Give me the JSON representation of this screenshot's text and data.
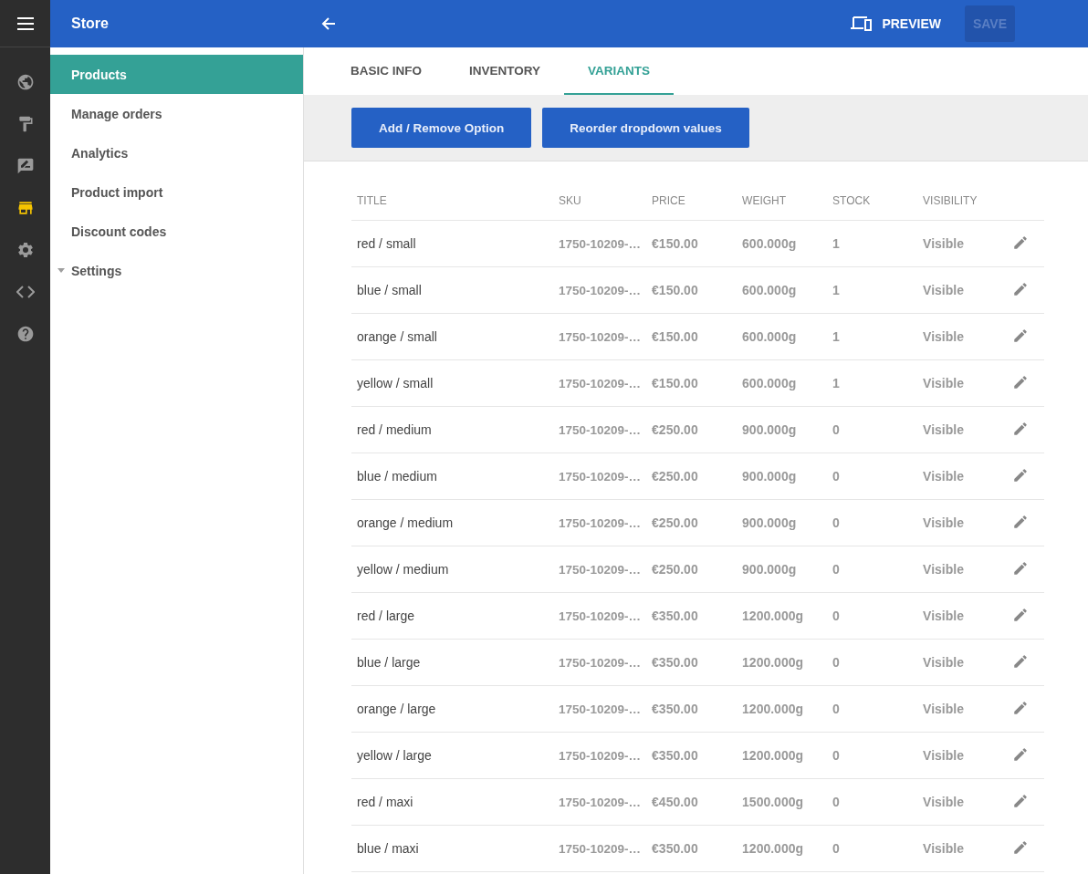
{
  "rail": [
    {
      "kind": "menu",
      "selected": false
    },
    {
      "kind": "globe",
      "selected": false
    },
    {
      "kind": "roller",
      "selected": false
    },
    {
      "kind": "feedback",
      "selected": false
    },
    {
      "kind": "store",
      "selected": true
    },
    {
      "kind": "gear",
      "selected": false
    },
    {
      "kind": "code",
      "selected": false
    },
    {
      "kind": "help",
      "selected": false
    }
  ],
  "sidebar": {
    "title": "Store",
    "items": [
      {
        "label": "Products",
        "selected": true,
        "kind": "link"
      },
      {
        "label": "Manage orders",
        "selected": false,
        "kind": "link"
      },
      {
        "label": "Analytics",
        "selected": false,
        "kind": "link"
      },
      {
        "label": "Product import",
        "selected": false,
        "kind": "link"
      },
      {
        "label": "Discount codes",
        "selected": false,
        "kind": "link"
      },
      {
        "label": "Settings",
        "selected": false,
        "kind": "group"
      }
    ]
  },
  "topbar": {
    "preview": "PREVIEW",
    "save": {
      "label": "SAVE",
      "disabled": true
    }
  },
  "tabs": [
    {
      "label": "BASIC INFO",
      "selected": false
    },
    {
      "label": "INVENTORY",
      "selected": false
    },
    {
      "label": "VARIANTS",
      "selected": true
    }
  ],
  "actions": [
    "Add / Remove Option",
    "Reorder dropdown values"
  ],
  "table": {
    "columns": [
      "TITLE",
      "SKU",
      "PRICE",
      "WEIGHT",
      "STOCK",
      "VISIBILITY"
    ],
    "rows": [
      [
        "red / small",
        "1750-10209-…",
        "€150.00",
        "600.000g",
        "1",
        "Visible"
      ],
      [
        "blue / small",
        "1750-10209-…",
        "€150.00",
        "600.000g",
        "1",
        "Visible"
      ],
      [
        "orange / small",
        "1750-10209-…",
        "€150.00",
        "600.000g",
        "1",
        "Visible"
      ],
      [
        "yellow / small",
        "1750-10209-…",
        "€150.00",
        "600.000g",
        "1",
        "Visible"
      ],
      [
        "red / medium",
        "1750-10209-…",
        "€250.00",
        "900.000g",
        "0",
        "Visible"
      ],
      [
        "blue / medium",
        "1750-10209-…",
        "€250.00",
        "900.000g",
        "0",
        "Visible"
      ],
      [
        "orange / medium",
        "1750-10209-…",
        "€250.00",
        "900.000g",
        "0",
        "Visible"
      ],
      [
        "yellow / medium",
        "1750-10209-…",
        "€250.00",
        "900.000g",
        "0",
        "Visible"
      ],
      [
        "red / large",
        "1750-10209-…",
        "€350.00",
        "1200.000g",
        "0",
        "Visible"
      ],
      [
        "blue / large",
        "1750-10209-…",
        "€350.00",
        "1200.000g",
        "0",
        "Visible"
      ],
      [
        "orange / large",
        "1750-10209-…",
        "€350.00",
        "1200.000g",
        "0",
        "Visible"
      ],
      [
        "yellow / large",
        "1750-10209-…",
        "€350.00",
        "1200.000g",
        "0",
        "Visible"
      ],
      [
        "red / maxi",
        "1750-10209-…",
        "€450.00",
        "1500.000g",
        "0",
        "Visible"
      ],
      [
        "blue / maxi",
        "1750-10209-…",
        "€350.00",
        "1200.000g",
        "0",
        "Visible"
      ]
    ]
  }
}
